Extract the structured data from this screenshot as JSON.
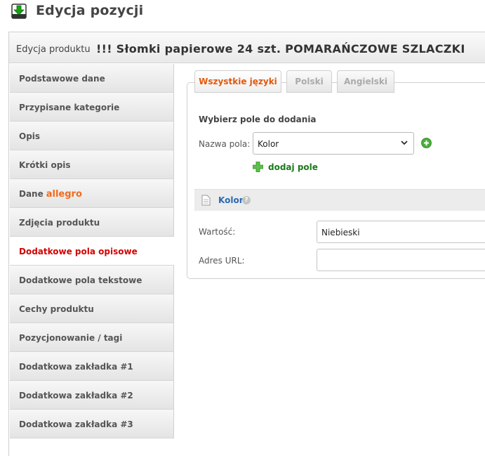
{
  "header": {
    "title": "Edycja pozycji",
    "icon": "download-page-icon"
  },
  "product": {
    "prefix": "Edycja produktu",
    "name": "!!! Słomki papierowe 24 szt. POMARAŃCZOWE SZLACZKI"
  },
  "sidebar": {
    "items": [
      {
        "label": "Podstawowe dane"
      },
      {
        "label": "Przypisane kategorie"
      },
      {
        "label": "Opis"
      },
      {
        "label": "Krótki opis"
      },
      {
        "label": "Dane",
        "badge": "allegro"
      },
      {
        "label": "Zdjęcia produktu"
      },
      {
        "label": "Dodatkowe pola opisowe",
        "active": true
      },
      {
        "label": "Dodatkowe pola tekstowe"
      },
      {
        "label": "Cechy produktu"
      },
      {
        "label": "Pozycjonowanie / tagi"
      },
      {
        "label": "Dodatkowa zakładka #1"
      },
      {
        "label": "Dodatkowa zakładka #2"
      },
      {
        "label": "Dodatkowa zakładka #3"
      }
    ]
  },
  "tabs": [
    {
      "label": "Wszystkie języki",
      "active": true
    },
    {
      "label": "Polski"
    },
    {
      "label": "Angielski"
    }
  ],
  "add_section": {
    "title": "Wybierz pole do dodania",
    "field_label": "Nazwa pola:",
    "select_value": "Kolor",
    "add_label": "dodaj pole"
  },
  "attribute": {
    "name": "Kolor",
    "help": "?",
    "value_label": "Wartość:",
    "value": "Niebieski",
    "url_label": "Adres URL:",
    "url_value": ""
  },
  "colors": {
    "active_tab": "#e4580b",
    "active_sidebar": "#d40000",
    "add_green": "#1a7a1a",
    "link_blue": "#2a6ab0",
    "allegro": "#f26a1b"
  }
}
